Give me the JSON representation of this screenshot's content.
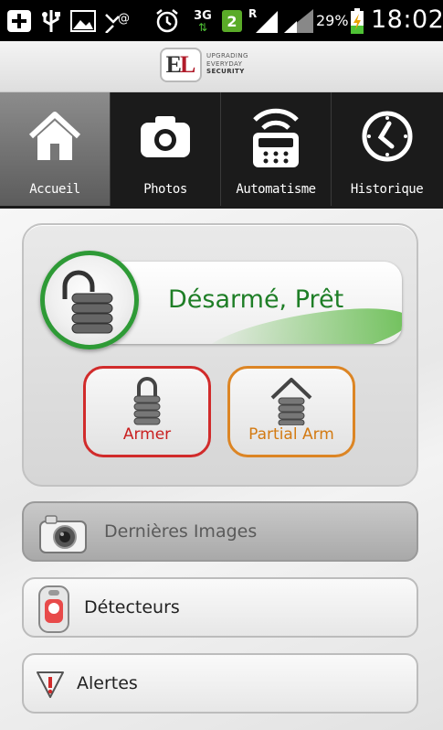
{
  "status_bar": {
    "battery_percent": "29%",
    "time": "18:02",
    "network_type": "3G",
    "notification_count": "2",
    "roaming_indicator": "R"
  },
  "header": {
    "logo_letter_e": "E",
    "logo_letter_l": "L",
    "tagline": [
      "UPGRADING",
      "EVERYDAY",
      "SECURITY"
    ]
  },
  "nav": {
    "tabs": [
      {
        "label": "Accueil",
        "icon": "home-icon",
        "active": true
      },
      {
        "label": "Photos",
        "icon": "camera-icon",
        "active": false
      },
      {
        "label": "Automatisme",
        "icon": "automation-icon",
        "active": false
      },
      {
        "label": "Historique",
        "icon": "clock-icon",
        "active": false
      }
    ]
  },
  "alarm": {
    "state_text": "Désarmé, Prêt",
    "state_color": "#1e7e26",
    "arm_label": "Armer",
    "arm_color": "#d12b2b",
    "partial_arm_label": "Partial Arm",
    "partial_arm_color": "#dc8524"
  },
  "menu": {
    "items": [
      {
        "label": "Dernières Images",
        "icon": "camera-icon",
        "disabled": true
      },
      {
        "label": "Détecteurs",
        "icon": "detector-icon",
        "disabled": false
      },
      {
        "label": "Alertes",
        "icon": "alert-icon",
        "disabled": false
      }
    ]
  }
}
